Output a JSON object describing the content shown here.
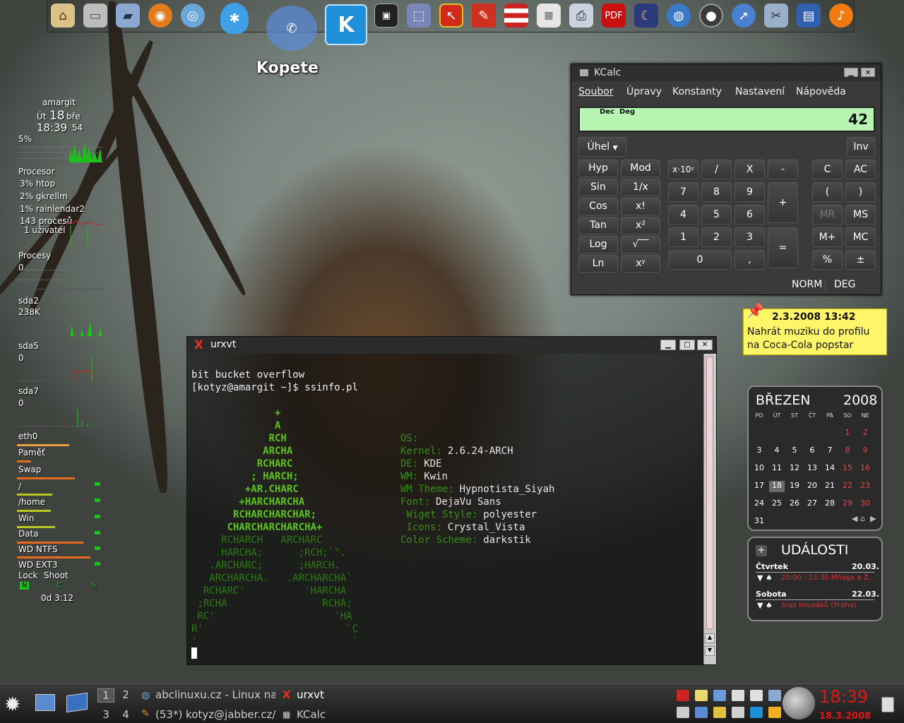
{
  "dock": {
    "icons": [
      "home-icon",
      "drive-icon",
      "removable-drive-icon",
      "firefox-icon",
      "world-icon",
      "tips-icon",
      "kopete-icon",
      "kopete-k-icon",
      "terminal-icon",
      "selection-icon",
      "screenshot-icon",
      "pen-icon",
      "usa-flag-icon",
      "keyboard-icon",
      "printer-icon",
      "pdf-icon",
      "night-icon",
      "globe-icon",
      "media-icon",
      "browser-icon",
      "film-icon",
      "clapboard-icon",
      "music-icon"
    ],
    "tooltip": "Kopete"
  },
  "sysmon": {
    "host": "amargit",
    "day": "Út",
    "date_num": "18",
    "month": "bře",
    "time": "18:39",
    "seconds": "54",
    "cpu": "5%",
    "proc_label": "Procesor",
    "top1": "3% htop",
    "top2": "2% gkrellm",
    "top3": "1% rainlendar2",
    "procs": "143 procesů",
    "users": "1 uživatel",
    "procesy": "Procesy",
    "procesy_val": "0",
    "sda2": "sda2",
    "sda2_val": "238K",
    "sda5": "sda5",
    "sda5_val": "0",
    "sda7": "sda7",
    "sda7_val": "0",
    "eth0": "eth0",
    "mem": "Paměť",
    "swap": "Swap",
    "root": "/",
    "home": "/home",
    "win": "Win",
    "data": "Data",
    "wdntfs": "WD NTFS",
    "wdext3": "WD EXT3",
    "lock": "Lock",
    "shoot": "Shoot",
    "n": "N",
    "c": "C",
    "s": "S",
    "uptime": "0d  3:12"
  },
  "kcalc": {
    "title": "KCalc",
    "menu": [
      "Soubor",
      "Úpravy",
      "Konstanty",
      "Nastavení",
      "Nápověda"
    ],
    "mode": "Dec  Deg",
    "display": "42",
    "angle": "Úhel",
    "inv": "Inv",
    "func": [
      "Hyp",
      "Mod",
      "Sin",
      "1/x",
      "Cos",
      "x!",
      "Tan",
      "x²",
      "Log",
      "√‾‾",
      "Ln",
      "xʸ"
    ],
    "ops": [
      "x·10ʸ",
      "/",
      "X",
      "-",
      "7",
      "8",
      "9",
      "+",
      "4",
      "5",
      "6",
      "1",
      "2",
      "3",
      "=",
      "0",
      ","
    ],
    "mem": [
      "C",
      "AC",
      "(",
      ")",
      "MR",
      "MS",
      "M+",
      "MC",
      "%",
      "±"
    ],
    "status1": "NORM",
    "status2": "DEG"
  },
  "urxvt": {
    "title": "urxvt",
    "line1": "bit bucket overflow",
    "line2": "[kotyz@amargit ~]$ ssinfo.pl",
    "logo": [
      "              +",
      "              A",
      "             RCH",
      "            ARCHA",
      "           RCHARC",
      "          ; HARCH;",
      "         +AR.CHARC",
      "        +HARCHARCHA",
      "       RCHARCHARCHAR;",
      "      CHARCHARCHARCHA+",
      "     RCHARCH   ARCHARC",
      "    .HARCHA;      ;RCH;`\".",
      "   .ARCHARC;      ;HARCH.",
      "   ARCHARCHA.   .ARCHARCHA`",
      "  RCHARC'          'HARCHA",
      " ;RCHA                RCHA;",
      " RC'                    'HA",
      "R'                        `C",
      "'                          `"
    ],
    "info_keys": [
      "OS:",
      "Kernel:",
      "DE:",
      "WM:",
      "WM Theme:",
      "Font:",
      " Wiget Style:",
      " Icons:",
      "Color Scheme:"
    ],
    "info_vals": [
      "",
      "2.6.24-ARCH",
      "KDE",
      "Kwin",
      "Hypnotista_Siyah",
      "DejaVu Sans",
      "polyester",
      "Crystal_Vista",
      "darkstik"
    ]
  },
  "note": {
    "date": "2.3.2008 13:42",
    "text1": "Nahrát muziku do profilu",
    "text2": "na Coca-Cola popstar"
  },
  "calendar": {
    "month": "BŘEZEN",
    "year": "2008",
    "weekdays": [
      "PO",
      "ÚT",
      "ST",
      "ČT",
      "PÁ",
      "SO",
      "NE"
    ],
    "rows": [
      [
        "",
        "",
        "",
        "",
        "",
        "1",
        "2"
      ],
      [
        "3",
        "4",
        "5",
        "6",
        "7",
        "8",
        "9"
      ],
      [
        "10",
        "11",
        "12",
        "13",
        "14",
        "15",
        "16"
      ],
      [
        "17",
        "18",
        "19",
        "20",
        "21",
        "22",
        "23"
      ],
      [
        "24",
        "25",
        "26",
        "27",
        "28",
        "29",
        "30"
      ],
      [
        "31",
        "",
        "",
        "",
        "",
        "",
        ""
      ]
    ]
  },
  "events": {
    "title": "UDÁLOSTI",
    "e1_day": "Čtvrtek",
    "e1_date": "20.03.",
    "e1_text": "20:00 - 23:30 Mňága a Ž...",
    "e2_day": "Sobota",
    "e2_date": "22.03.",
    "e2_text": "Sraz linuxáků (Praha)"
  },
  "taskbar": {
    "desk": [
      "1",
      "2",
      "3",
      "4"
    ],
    "task1": "abclinuxu.cz - Linux na",
    "task2": "urxvt",
    "task3": "(53*) kotyz@jabber.cz/",
    "task4": "KCalc",
    "clock": "18:39",
    "date": "18.3.2008"
  },
  "colors": {
    "term_green": "#5ec21e",
    "term_info": "#3a8a1a",
    "calc_display": "#b8f5b2",
    "clock_red": "#e01818"
  }
}
